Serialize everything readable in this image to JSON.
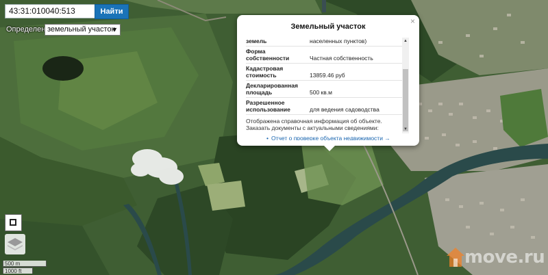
{
  "search": {
    "value": "43:31:010040:513",
    "button_label": "Найти"
  },
  "definition": {
    "label": "Определение",
    "selected": "земельный участок"
  },
  "popup": {
    "title": "Земельный участок",
    "close_symbol": "×",
    "rows": [
      {
        "key": "земель",
        "value": "населенных пунктов)"
      },
      {
        "key": "Форма собственности",
        "value": "Частная собственность"
      },
      {
        "key": "Кадастровая стоимость",
        "value": "13859.46 руб"
      },
      {
        "key": "Декларированная площадь",
        "value": "500 кв.м"
      },
      {
        "key": "Разрешенное использование",
        "value": "для ведения садоводства"
      }
    ],
    "note_line1": "Отображена справочная информация об объекте.",
    "note_line2": "Заказать документы с актуальными сведениями:",
    "report_link": "Отчет о проверке объекта недвижимости →"
  },
  "scale": {
    "metric": "500 m",
    "imperial": "1000 ft"
  },
  "watermark": {
    "text": "move.ru",
    "icon": "house-icon"
  },
  "icons": {
    "close": "close-icon",
    "layers": "layers-icon",
    "tool": "square-tool-icon"
  },
  "colors": {
    "button": "#1a73b8",
    "link": "#1a66b0",
    "popup_bg": "#ffffff"
  }
}
